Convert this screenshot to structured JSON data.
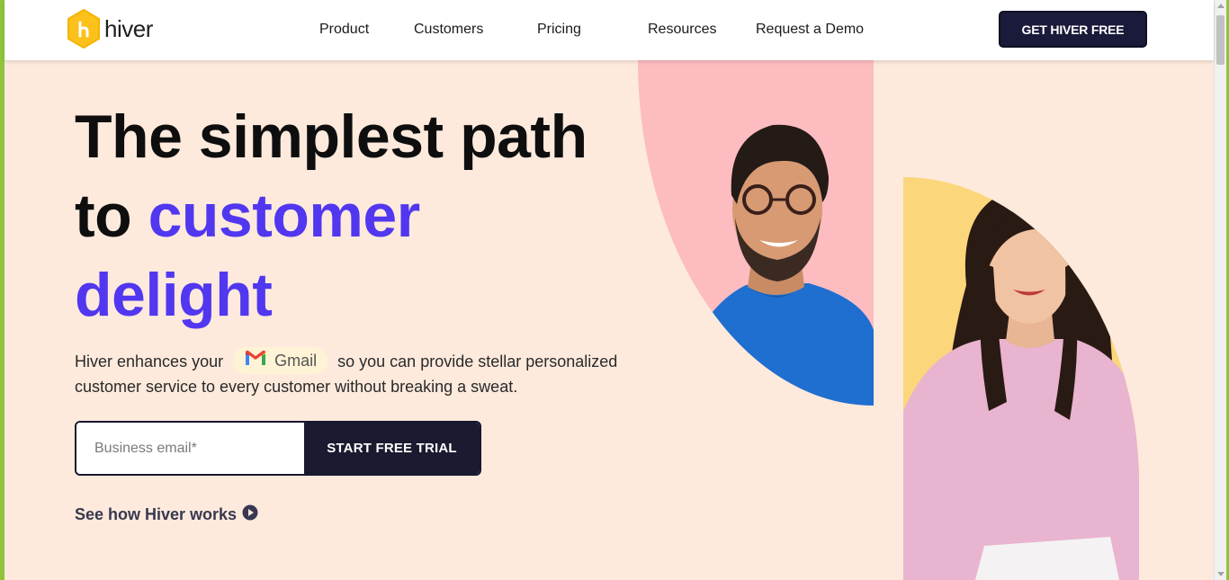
{
  "brand": {
    "name": "hiver",
    "accent": "#5137f0",
    "logo_color": "#fcc21b"
  },
  "nav": {
    "items": [
      {
        "label": "Product"
      },
      {
        "label": "Customers"
      },
      {
        "label": "Pricing"
      },
      {
        "label": "Resources"
      },
      {
        "label": "Request a Demo"
      }
    ],
    "cta": "GET HIVER FREE"
  },
  "hero": {
    "title_line1": "The simplest path",
    "title_line2_a": "to ",
    "title_line2_b": "customer",
    "title_line3": "delight",
    "desc_before": "Hiver enhances your",
    "gmail_label": "Gmail",
    "desc_after": "so you can provide stellar personalized customer service to every customer without breaking a sweat.",
    "email_placeholder": "Business email*",
    "trial_button": "START FREE TRIAL",
    "see_how": "See how Hiver works"
  },
  "icons": [
    "hiver-logo-icon",
    "gmail-icon",
    "play-circle-icon"
  ]
}
